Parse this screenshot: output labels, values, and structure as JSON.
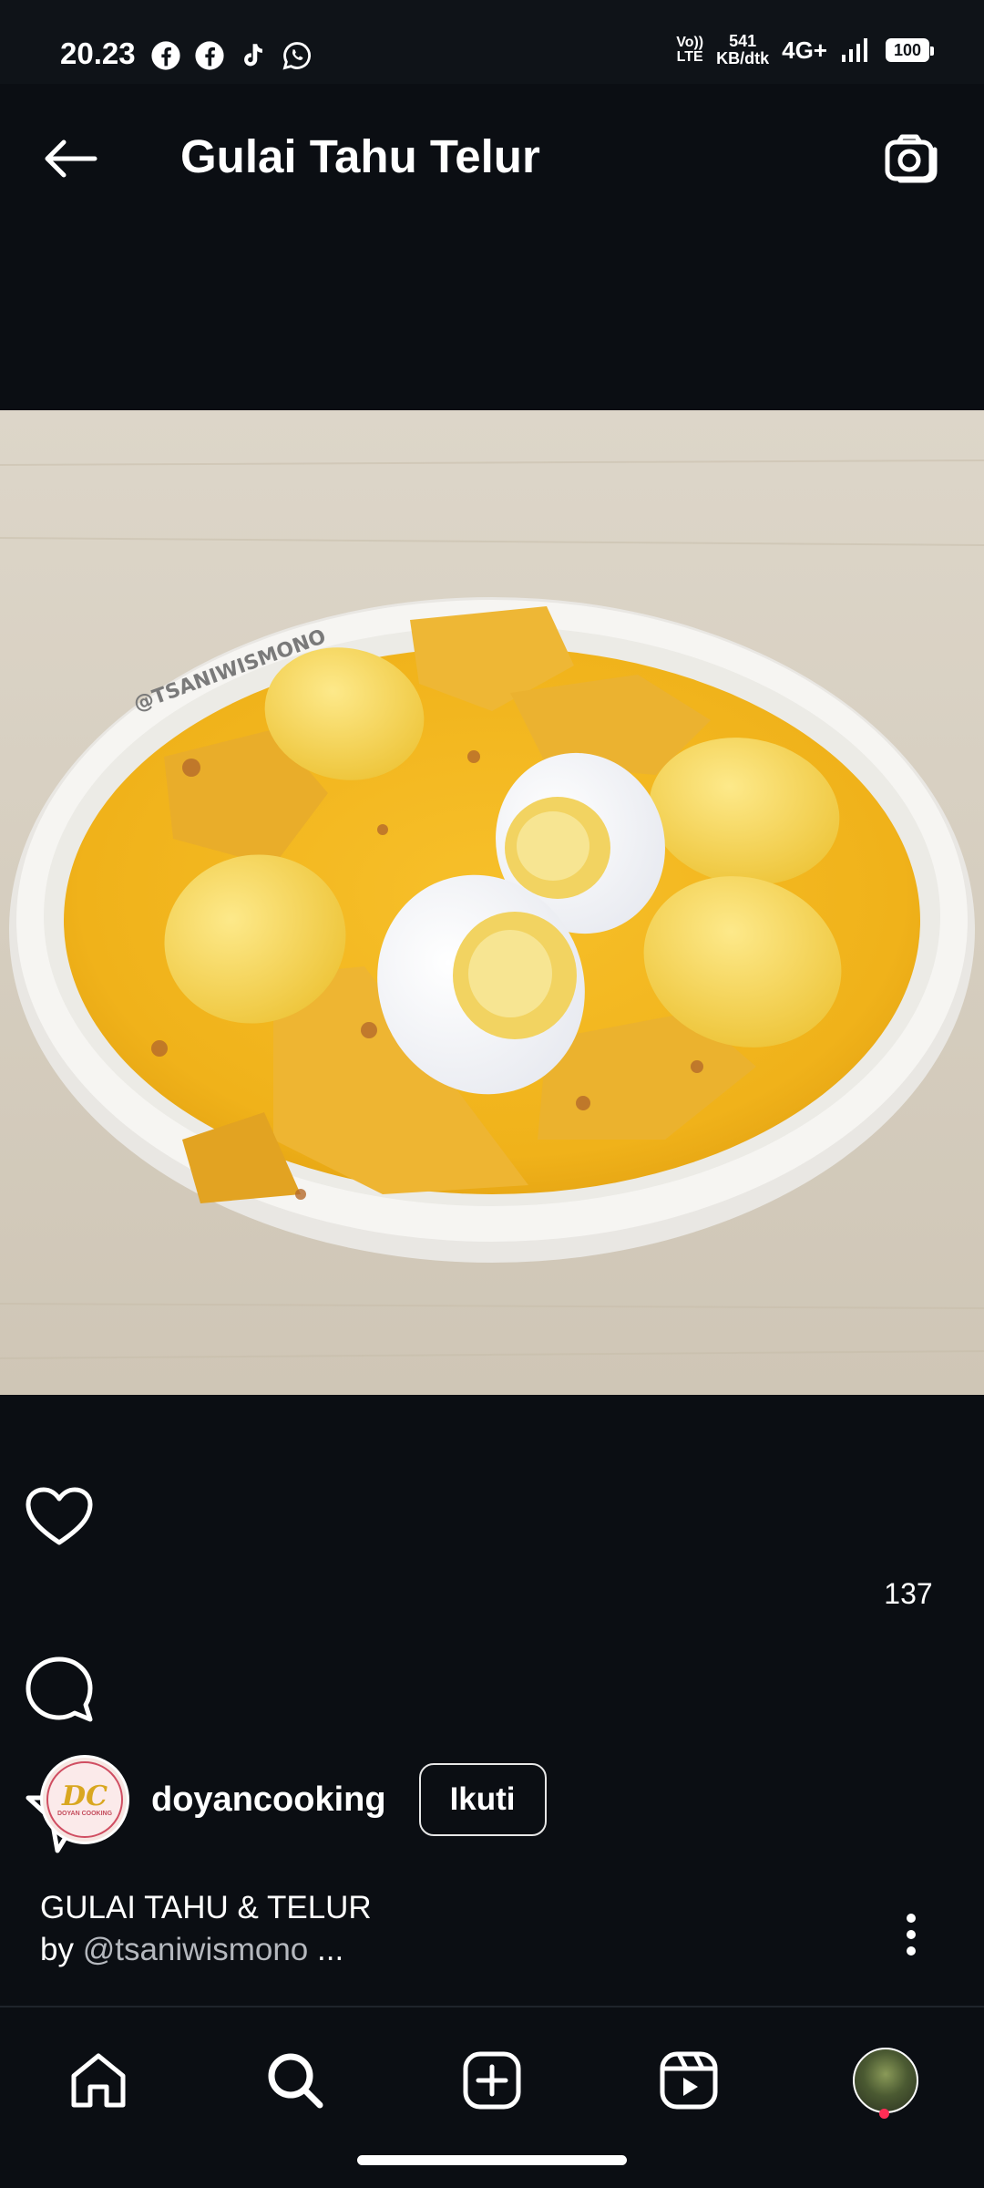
{
  "status_bar": {
    "time": "20.23",
    "volte_top": "Vo))",
    "volte_bottom": "LTE",
    "speed_value": "541",
    "speed_unit": "KB/dtk",
    "network": "4G+",
    "battery": "100",
    "app_icons": [
      "facebook-icon",
      "facebook-icon",
      "tiktok-icon",
      "whatsapp-icon"
    ]
  },
  "header": {
    "title": "Gulai Tahu Telur",
    "back_icon": "arrow-left-icon",
    "camera_icon": "camera-icon"
  },
  "post": {
    "watermark": "@TSANIWISMONO",
    "likes": "137"
  },
  "author": {
    "avatar_text": "DC",
    "avatar_subtext": "DOYAN COOKING",
    "username": "doyancooking",
    "follow_label": "Ikuti"
  },
  "caption": {
    "line1": "GULAI TAHU & TELUR",
    "by_prefix": "by ",
    "mention": "@tsaniwismono",
    "more": " ..."
  },
  "bottom_nav": {
    "items": [
      "home-icon",
      "search-icon",
      "create-icon",
      "reels-icon",
      "profile-avatar"
    ]
  },
  "colors": {
    "background": "#0b0e13",
    "curry": "#f2b51c",
    "notification": "#ff2d55"
  }
}
